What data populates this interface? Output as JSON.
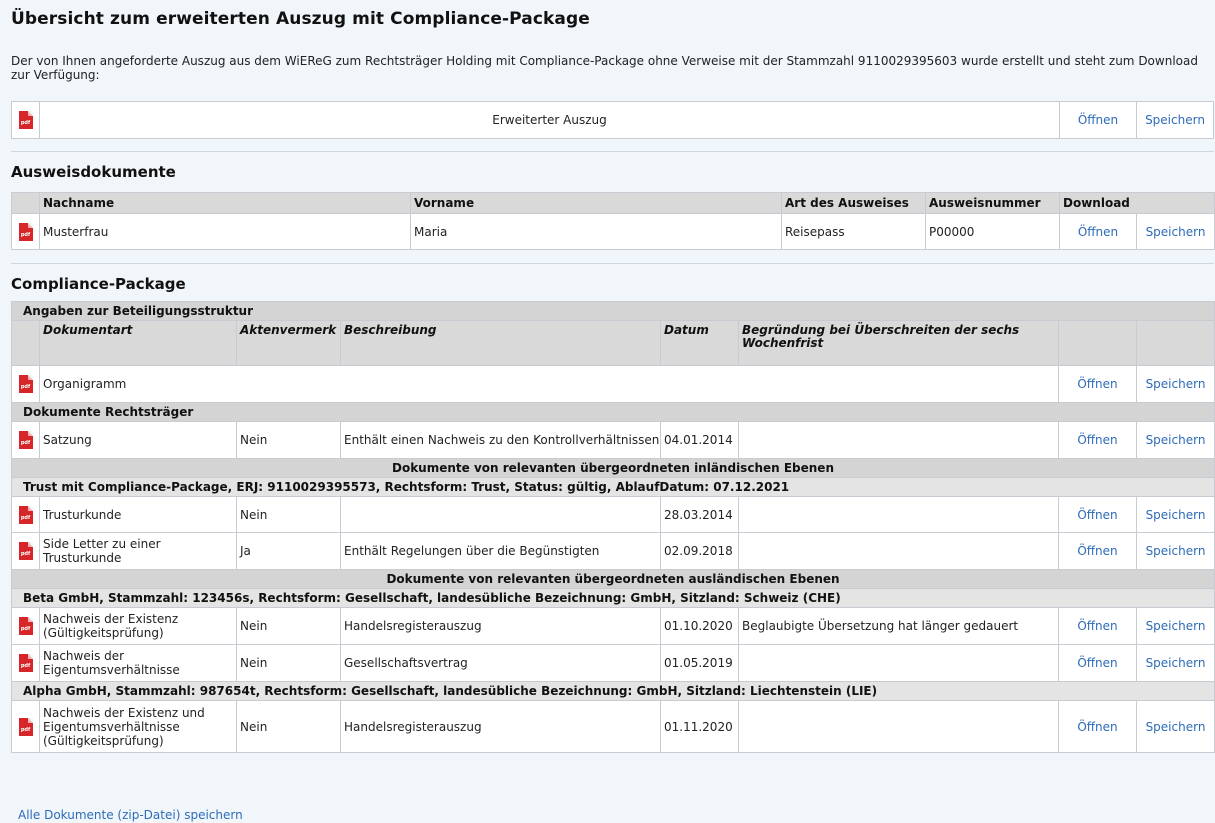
{
  "title": "Übersicht zum erweiterten Auszug mit Compliance-Package",
  "intro": "Der von Ihnen angeforderte Auszug aus dem WiEReG zum Rechtsträger Holding mit Compliance-Package ohne Verweise mit der Stammzahl 9110029395603 wurde erstellt und steht zum Download zur Verfügung:",
  "icons": {
    "pdf": "pdf-file-icon",
    "pdf_text": "pdf"
  },
  "colors": {
    "link": "#2e6bb8",
    "pdf_icon": "#d6262a",
    "section_bg": "#d4d4d4",
    "page_bg": "#f0f6fa"
  },
  "actions": {
    "open": "Öffnen",
    "save": "Speichern"
  },
  "auszug": {
    "label": "Erweiterter Auszug"
  },
  "ausweis": {
    "heading": "Ausweisdokumente",
    "columns": {
      "nachname": "Nachname",
      "vorname": "Vorname",
      "art": "Art des Ausweises",
      "nummer": "Ausweisnummer",
      "download": "Download"
    },
    "rows": [
      {
        "nachname": "Musterfrau",
        "vorname": "Maria",
        "art": "Reisepass",
        "nummer": "P00000"
      }
    ]
  },
  "compliance": {
    "heading": "Compliance-Package",
    "beteiligung_heading": "Angaben zur Beteiligungsstruktur",
    "columns": {
      "dokumentart": "Dokumentart",
      "aktenvermerk": "Aktenvermerk",
      "beschreibung": "Beschreibung",
      "datum": "Datum",
      "begruendung": "Begründung bei Überschreiten der sechs Wochenfrist"
    },
    "organigramm": {
      "dokumentart": "Organigramm"
    },
    "rechtstraeger_heading": "Dokumente Rechtsträger",
    "satzung": {
      "dokumentart": "Satzung",
      "aktenvermerk": "Nein",
      "beschreibung": "Enthält einen Nachweis zu den Kontrollverhältnissen",
      "datum": "04.01.2014",
      "begruendung": ""
    },
    "inland_heading": "Dokumente von relevanten übergeordneten inländischen Ebenen",
    "trust_heading": "Trust mit Compliance-Package, ERJ: 9110029395573, Rechtsform: Trust, Status: gültig, AblaufDatum: 07.12.2021",
    "trust_rows": [
      {
        "dokumentart": "Trusturkunde",
        "aktenvermerk": "Nein",
        "beschreibung": "",
        "datum": "28.03.2014",
        "begruendung": ""
      },
      {
        "dokumentart": "Side Letter zu einer Trusturkunde",
        "aktenvermerk": "Ja",
        "beschreibung": "Enthält Regelungen über die Begünstigten",
        "datum": "02.09.2018",
        "begruendung": ""
      }
    ],
    "ausland_heading": "Dokumente von relevanten übergeordneten ausländischen Ebenen",
    "beta_heading": "Beta GmbH, Stammzahl: 123456s, Rechtsform: Gesellschaft, landesübliche Bezeichnung: GmbH, Sitzland: Schweiz (CHE)",
    "beta_rows": [
      {
        "dokumentart": "Nachweis der Existenz (Gültigkeitsprüfung)",
        "aktenvermerk": "Nein",
        "beschreibung": "Handelsregisterauszug",
        "datum": "01.10.2020",
        "begruendung": "Beglaubigte Übersetzung hat länger gedauert"
      },
      {
        "dokumentart": "Nachweis der Eigentumsverhältnisse",
        "aktenvermerk": "Nein",
        "beschreibung": "Gesellschaftsvertrag",
        "datum": "01.05.2019",
        "begruendung": ""
      }
    ],
    "alpha_heading": "Alpha GmbH, Stammzahl: 987654t, Rechtsform: Gesellschaft, landesübliche Bezeichnung: GmbH, Sitzland: Liechtenstein (LIE)",
    "alpha_rows": [
      {
        "dokumentart": "Nachweis der Existenz und Eigentumsverhältnisse (Gültigkeitsprüfung)",
        "aktenvermerk": "Nein",
        "beschreibung": "Handelsregisterauszug",
        "datum": "01.11.2020",
        "begruendung": ""
      }
    ]
  },
  "zip_link": "Alle Dokumente (zip-Datei) speichern"
}
